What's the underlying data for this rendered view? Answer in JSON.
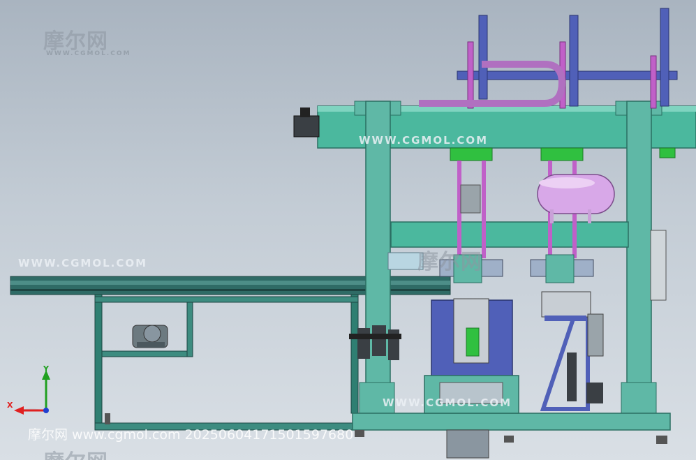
{
  "watermarks": {
    "logo_text": "摩尔网",
    "logo_url": "WWW.CGMOL.COM",
    "banner_url": "WWW.CGMOL.COM",
    "footer_text": "摩尔网 www.cgmol.com 20250604171501597680"
  },
  "triad": {
    "x_label": "X",
    "y_label": "Y",
    "x_color": "#e02020",
    "y_color": "#20a020",
    "z_color": "#2040d0"
  },
  "colors": {
    "frame": "#5fb8a6",
    "frame_dark": "#2f7f72",
    "beam": "#4bb89e",
    "conveyor": "#2f6b66",
    "blue_part": "#5060b8",
    "magenta_rod": "#c060c8",
    "tank": "#d8a8e8",
    "green_block": "#30c040"
  }
}
